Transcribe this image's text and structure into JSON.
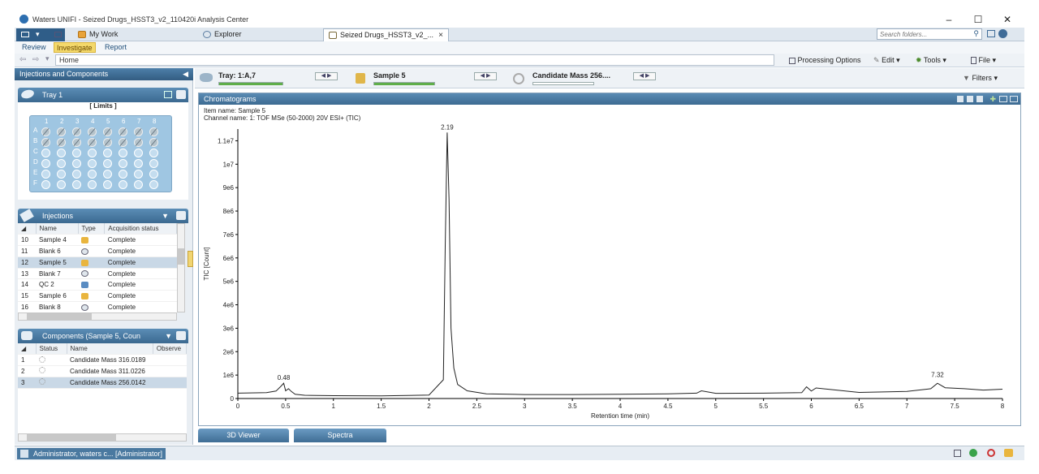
{
  "window": {
    "title": "Waters UNIFI - Seized Drugs_HSST3_v2_110420i Analysis Center"
  },
  "tabs": [
    {
      "label": "My Work"
    },
    {
      "label": "Explorer"
    },
    {
      "label": "Seized Drugs_HSST3_v2_..."
    }
  ],
  "search": {
    "placeholder": "Search folders..."
  },
  "ribbon": {
    "tabs": [
      "Review",
      "Investigate",
      "Report"
    ],
    "selected": "Investigate"
  },
  "address": {
    "value": "Home"
  },
  "toolbar": {
    "processing_options": "Processing Options",
    "edit": "Edit",
    "tools": "Tools",
    "file": "File",
    "filters": "Filters"
  },
  "left": {
    "panel_title": "Injections and Components",
    "tray": {
      "title": "Tray 1",
      "limits": "[ Limits ]",
      "cols": [
        "1",
        "2",
        "3",
        "4",
        "5",
        "6",
        "7",
        "8"
      ],
      "rows": [
        "A",
        "B",
        "C",
        "D",
        "E",
        "F"
      ]
    },
    "injections": {
      "title": "Injections",
      "headers": [
        "Name",
        "Type",
        "Acquisition status"
      ],
      "rows": [
        {
          "num": "10",
          "name": "Sample 4",
          "type": "sample",
          "status": "Complete"
        },
        {
          "num": "11",
          "name": "Blank 6",
          "type": "blank",
          "status": "Complete"
        },
        {
          "num": "12",
          "name": "Sample 5",
          "type": "sample",
          "status": "Complete"
        },
        {
          "num": "13",
          "name": "Blank 7",
          "type": "blank",
          "status": "Complete"
        },
        {
          "num": "14",
          "name": "QC 2",
          "type": "qc",
          "status": "Complete"
        },
        {
          "num": "15",
          "name": "Sample 6",
          "type": "sample",
          "status": "Complete"
        },
        {
          "num": "16",
          "name": "Blank 8",
          "type": "blank",
          "status": "Complete"
        }
      ]
    },
    "components": {
      "title": "Components (Sample 5, Coun",
      "headers": [
        "Status",
        "Name",
        "Observe"
      ],
      "rows": [
        {
          "num": "1",
          "name": "Candidate Mass 316.0189"
        },
        {
          "num": "2",
          "name": "Candidate Mass 311.0226"
        },
        {
          "num": "3",
          "name": "Candidate Mass 256.0142"
        }
      ]
    }
  },
  "selectors": {
    "tray": "Tray: 1:A,7",
    "sample": "Sample 5",
    "candidate": "Candidate Mass 256...."
  },
  "chromatogram": {
    "panel_title": "Chromatograms",
    "item_name": "Item name: Sample 5",
    "channel_name": "Channel name: 1: TOF MSe (50-2000) 20V ESI+ (TIC)"
  },
  "chart_data": {
    "type": "line",
    "xlabel": "Retention time (min)",
    "ylabel": "TIC [Count]",
    "xlim": [
      0,
      8
    ],
    "ylim": [
      0,
      11500000
    ],
    "x_ticks": [
      "0",
      "0.5",
      "1",
      "1.5",
      "2",
      "2.5",
      "3",
      "3.5",
      "4",
      "4.5",
      "5",
      "5.5",
      "6",
      "6.5",
      "7",
      "7.5",
      "8"
    ],
    "y_ticks": [
      {
        "v": 0,
        "label": "0"
      },
      {
        "v": 1000000,
        "label": "1e6"
      },
      {
        "v": 2000000,
        "label": "2e6"
      },
      {
        "v": 3000000,
        "label": "3e6"
      },
      {
        "v": 4000000,
        "label": "4e6"
      },
      {
        "v": 5000000,
        "label": "5e6"
      },
      {
        "v": 6000000,
        "label": "6e6"
      },
      {
        "v": 7000000,
        "label": "7e6"
      },
      {
        "v": 8000000,
        "label": "8e6"
      },
      {
        "v": 9000000,
        "label": "9e6"
      },
      {
        "v": 10000000,
        "label": "1e7"
      },
      {
        "v": 11000000,
        "label": "1.1e7"
      }
    ],
    "peak_labels": [
      {
        "x": 0.48,
        "y": 650000,
        "label": "0.48"
      },
      {
        "x": 2.19,
        "y": 11350000,
        "label": "2.19"
      },
      {
        "x": 7.32,
        "y": 780000,
        "label": "7.32"
      }
    ],
    "series": [
      {
        "x": [
          0,
          0.3,
          0.4,
          0.45,
          0.48,
          0.5,
          0.53,
          0.56,
          0.6,
          0.7,
          1.0,
          1.5,
          2.0,
          2.15,
          2.17,
          2.19,
          2.21,
          2.23,
          2.26,
          2.3,
          2.4,
          2.6,
          3.0,
          3.5,
          4.0,
          4.5,
          4.8,
          4.85,
          5.0,
          5.5,
          5.9,
          5.95,
          6.0,
          6.05,
          6.5,
          7.0,
          7.25,
          7.32,
          7.4,
          7.6,
          7.8,
          8.0
        ],
        "y": [
          230000,
          250000,
          320000,
          520000,
          650000,
          330000,
          420000,
          300000,
          180000,
          140000,
          120000,
          110000,
          150000,
          800000,
          6500000,
          11350000,
          8500000,
          3000000,
          1300000,
          600000,
          330000,
          200000,
          170000,
          170000,
          180000,
          200000,
          230000,
          330000,
          220000,
          230000,
          250000,
          500000,
          320000,
          450000,
          260000,
          300000,
          420000,
          650000,
          460000,
          420000,
          360000,
          400000
        ]
      }
    ]
  },
  "bottom_tabs": [
    "3D Viewer",
    "Spectra"
  ],
  "status": {
    "user": "Administrator, waters c... [Administrator]"
  }
}
